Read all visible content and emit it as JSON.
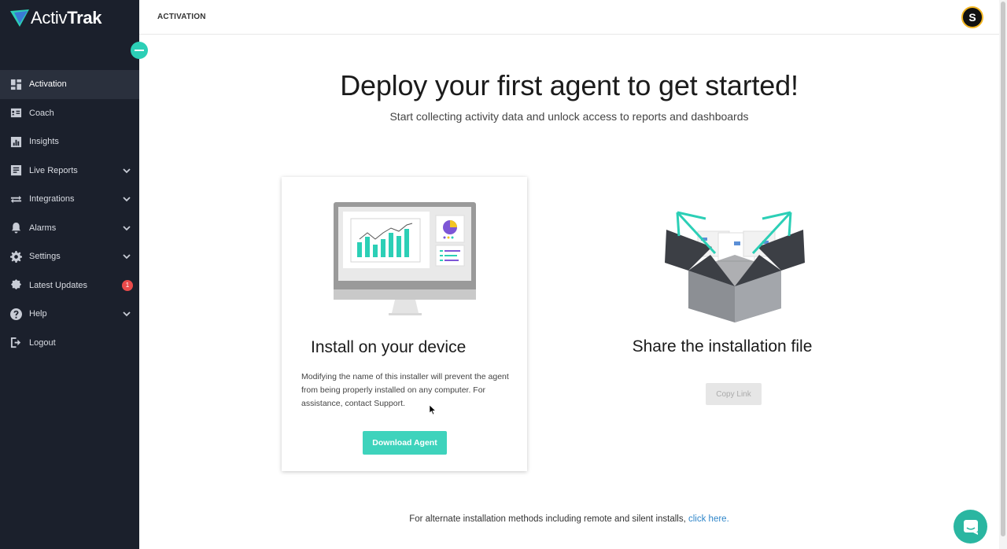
{
  "app": {
    "logo_text_light": "Activ",
    "logo_text_bold": "Trak"
  },
  "sidebar": {
    "items": [
      {
        "label": "Activation",
        "icon": "dashboard-icon"
      },
      {
        "label": "Coach",
        "icon": "coach-icon"
      },
      {
        "label": "Insights",
        "icon": "insights-icon"
      },
      {
        "label": "Live Reports",
        "icon": "reports-icon"
      },
      {
        "label": "Integrations",
        "icon": "integrations-icon"
      },
      {
        "label": "Alarms",
        "icon": "bell-icon"
      },
      {
        "label": "Settings",
        "icon": "gear-icon"
      },
      {
        "label": "Latest Updates",
        "icon": "updates-icon",
        "badge": "1"
      },
      {
        "label": "Help",
        "icon": "help-icon"
      },
      {
        "label": "Logout",
        "icon": "logout-icon"
      }
    ]
  },
  "header": {
    "title": "ACTIVATION",
    "avatar_initial": "S"
  },
  "main": {
    "title": "Deploy your first agent to get started!",
    "subtitle": "Start collecting activity data and unlock access to reports and dashboards"
  },
  "install_card": {
    "title": "Install on your device",
    "description": "Modifying the name of this installer will prevent the agent from being properly installed on any computer. For assistance, contact Support.",
    "button_label": "Download Agent"
  },
  "share": {
    "title": "Share the installation file",
    "button_label": "Copy Link"
  },
  "footer": {
    "text": "For alternate installation methods including remote and silent installs, ",
    "link_text": "click here."
  },
  "colors": {
    "sidebar_bg": "#1b202c",
    "accent": "#3ed3bc",
    "link": "#2f86c9",
    "badge": "#ea4a4a"
  }
}
